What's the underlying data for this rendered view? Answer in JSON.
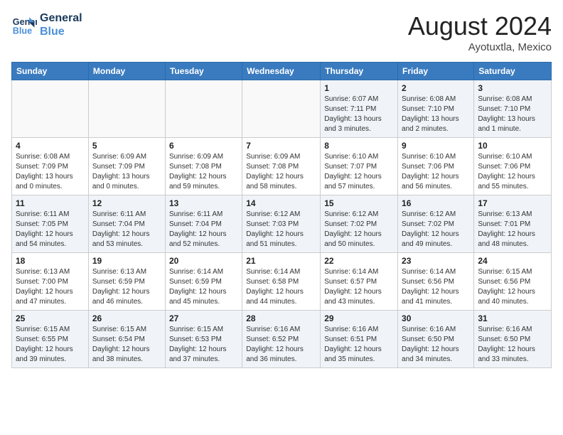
{
  "header": {
    "logo_line1": "General",
    "logo_line2": "Blue",
    "month_year": "August 2024",
    "location": "Ayotuxtla, Mexico"
  },
  "weekdays": [
    "Sunday",
    "Monday",
    "Tuesday",
    "Wednesday",
    "Thursday",
    "Friday",
    "Saturday"
  ],
  "weeks": [
    [
      {
        "day": "",
        "info": ""
      },
      {
        "day": "",
        "info": ""
      },
      {
        "day": "",
        "info": ""
      },
      {
        "day": "",
        "info": ""
      },
      {
        "day": "1",
        "info": "Sunrise: 6:07 AM\nSunset: 7:11 PM\nDaylight: 13 hours\nand 3 minutes."
      },
      {
        "day": "2",
        "info": "Sunrise: 6:08 AM\nSunset: 7:10 PM\nDaylight: 13 hours\nand 2 minutes."
      },
      {
        "day": "3",
        "info": "Sunrise: 6:08 AM\nSunset: 7:10 PM\nDaylight: 13 hours\nand 1 minute."
      }
    ],
    [
      {
        "day": "4",
        "info": "Sunrise: 6:08 AM\nSunset: 7:09 PM\nDaylight: 13 hours\nand 0 minutes."
      },
      {
        "day": "5",
        "info": "Sunrise: 6:09 AM\nSunset: 7:09 PM\nDaylight: 13 hours\nand 0 minutes."
      },
      {
        "day": "6",
        "info": "Sunrise: 6:09 AM\nSunset: 7:08 PM\nDaylight: 12 hours\nand 59 minutes."
      },
      {
        "day": "7",
        "info": "Sunrise: 6:09 AM\nSunset: 7:08 PM\nDaylight: 12 hours\nand 58 minutes."
      },
      {
        "day": "8",
        "info": "Sunrise: 6:10 AM\nSunset: 7:07 PM\nDaylight: 12 hours\nand 57 minutes."
      },
      {
        "day": "9",
        "info": "Sunrise: 6:10 AM\nSunset: 7:06 PM\nDaylight: 12 hours\nand 56 minutes."
      },
      {
        "day": "10",
        "info": "Sunrise: 6:10 AM\nSunset: 7:06 PM\nDaylight: 12 hours\nand 55 minutes."
      }
    ],
    [
      {
        "day": "11",
        "info": "Sunrise: 6:11 AM\nSunset: 7:05 PM\nDaylight: 12 hours\nand 54 minutes."
      },
      {
        "day": "12",
        "info": "Sunrise: 6:11 AM\nSunset: 7:04 PM\nDaylight: 12 hours\nand 53 minutes."
      },
      {
        "day": "13",
        "info": "Sunrise: 6:11 AM\nSunset: 7:04 PM\nDaylight: 12 hours\nand 52 minutes."
      },
      {
        "day": "14",
        "info": "Sunrise: 6:12 AM\nSunset: 7:03 PM\nDaylight: 12 hours\nand 51 minutes."
      },
      {
        "day": "15",
        "info": "Sunrise: 6:12 AM\nSunset: 7:02 PM\nDaylight: 12 hours\nand 50 minutes."
      },
      {
        "day": "16",
        "info": "Sunrise: 6:12 AM\nSunset: 7:02 PM\nDaylight: 12 hours\nand 49 minutes."
      },
      {
        "day": "17",
        "info": "Sunrise: 6:13 AM\nSunset: 7:01 PM\nDaylight: 12 hours\nand 48 minutes."
      }
    ],
    [
      {
        "day": "18",
        "info": "Sunrise: 6:13 AM\nSunset: 7:00 PM\nDaylight: 12 hours\nand 47 minutes."
      },
      {
        "day": "19",
        "info": "Sunrise: 6:13 AM\nSunset: 6:59 PM\nDaylight: 12 hours\nand 46 minutes."
      },
      {
        "day": "20",
        "info": "Sunrise: 6:14 AM\nSunset: 6:59 PM\nDaylight: 12 hours\nand 45 minutes."
      },
      {
        "day": "21",
        "info": "Sunrise: 6:14 AM\nSunset: 6:58 PM\nDaylight: 12 hours\nand 44 minutes."
      },
      {
        "day": "22",
        "info": "Sunrise: 6:14 AM\nSunset: 6:57 PM\nDaylight: 12 hours\nand 43 minutes."
      },
      {
        "day": "23",
        "info": "Sunrise: 6:14 AM\nSunset: 6:56 PM\nDaylight: 12 hours\nand 41 minutes."
      },
      {
        "day": "24",
        "info": "Sunrise: 6:15 AM\nSunset: 6:56 PM\nDaylight: 12 hours\nand 40 minutes."
      }
    ],
    [
      {
        "day": "25",
        "info": "Sunrise: 6:15 AM\nSunset: 6:55 PM\nDaylight: 12 hours\nand 39 minutes."
      },
      {
        "day": "26",
        "info": "Sunrise: 6:15 AM\nSunset: 6:54 PM\nDaylight: 12 hours\nand 38 minutes."
      },
      {
        "day": "27",
        "info": "Sunrise: 6:15 AM\nSunset: 6:53 PM\nDaylight: 12 hours\nand 37 minutes."
      },
      {
        "day": "28",
        "info": "Sunrise: 6:16 AM\nSunset: 6:52 PM\nDaylight: 12 hours\nand 36 minutes."
      },
      {
        "day": "29",
        "info": "Sunrise: 6:16 AM\nSunset: 6:51 PM\nDaylight: 12 hours\nand 35 minutes."
      },
      {
        "day": "30",
        "info": "Sunrise: 6:16 AM\nSunset: 6:50 PM\nDaylight: 12 hours\nand 34 minutes."
      },
      {
        "day": "31",
        "info": "Sunrise: 6:16 AM\nSunset: 6:50 PM\nDaylight: 12 hours\nand 33 minutes."
      }
    ]
  ]
}
